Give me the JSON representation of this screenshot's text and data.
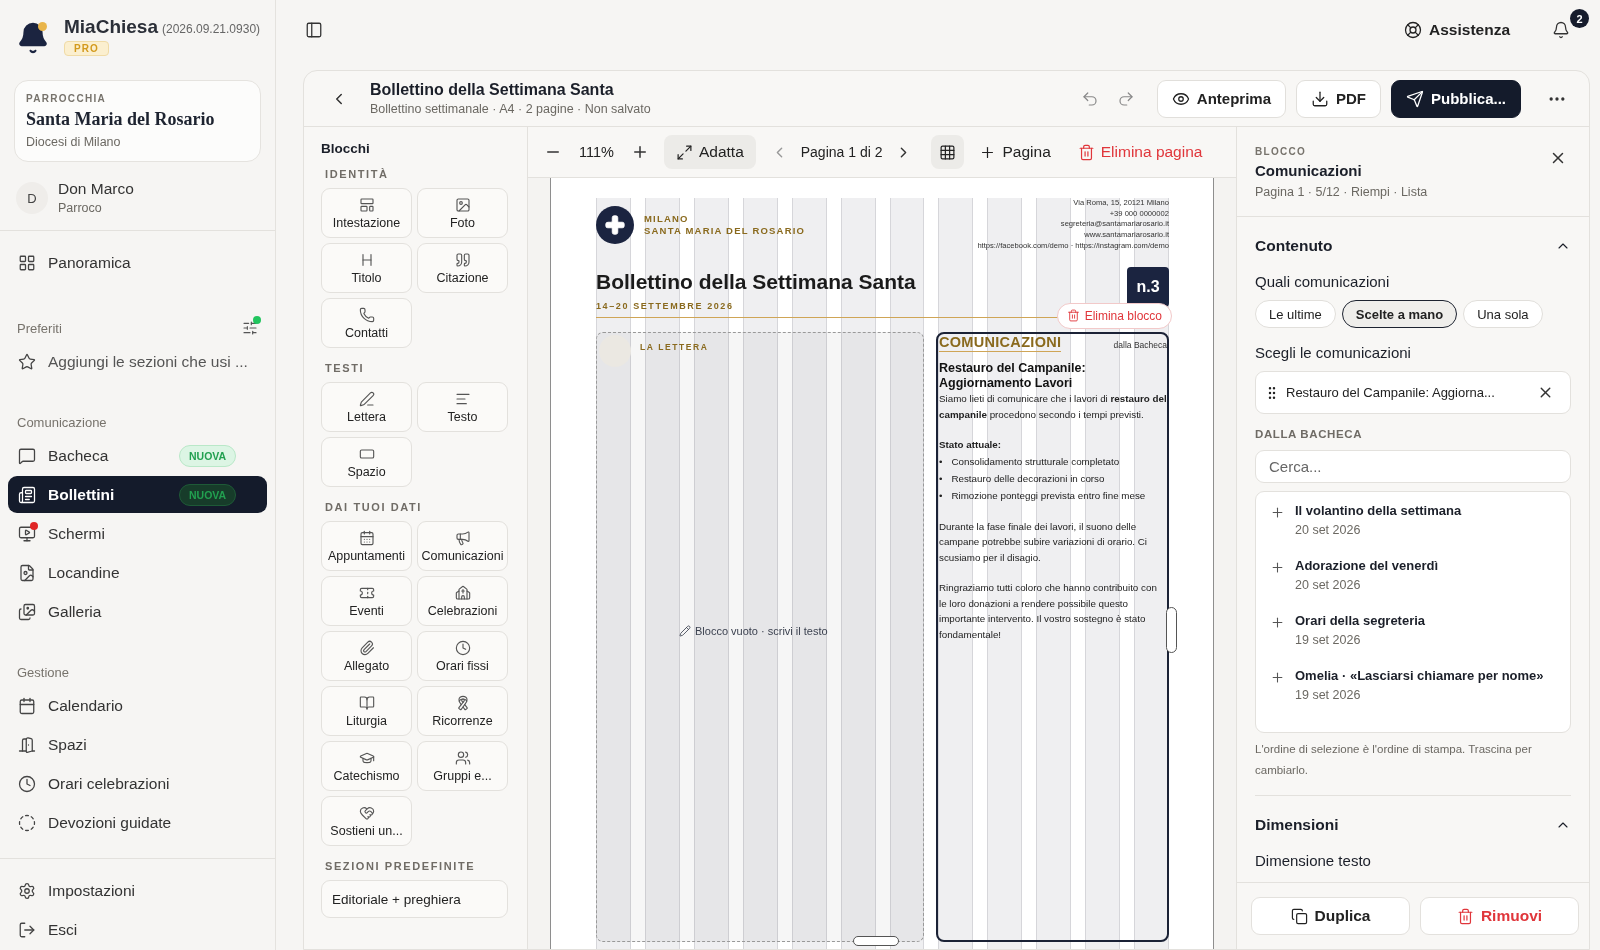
{
  "app": {
    "name": "MiaChiesa",
    "version": "(2026.09.21.0930)",
    "plan": "PRO"
  },
  "parish": {
    "label": "PARROCCHIA",
    "name": "Santa Maria del Rosario",
    "diocese": "Diocesi di Milano"
  },
  "user": {
    "initial": "D",
    "name": "Don Marco",
    "role": "Parroco"
  },
  "nav_top": [
    {
      "label": "Panoramica",
      "selected": false
    }
  ],
  "favorites": {
    "title": "Preferiti",
    "has_update": true,
    "hint": "Aggiungi le sezioni che usi ..."
  },
  "nav_sections": [
    {
      "title": "Comunicazione",
      "items": [
        {
          "label": "Bacheca",
          "badge": "NUOVA",
          "selected": false,
          "alert": false
        },
        {
          "label": "Bollettini",
          "badge": "NUOVA",
          "selected": true,
          "alert": false
        },
        {
          "label": "Schermi",
          "selected": false,
          "alert": true
        },
        {
          "label": "Locandine",
          "selected": false,
          "alert": false
        },
        {
          "label": "Galleria",
          "selected": false,
          "alert": false
        }
      ]
    },
    {
      "title": "Gestione",
      "items": [
        {
          "label": "Calendario",
          "selected": false,
          "alert": false
        },
        {
          "label": "Spazi",
          "selected": false,
          "alert": false
        },
        {
          "label": "Orari celebrazioni",
          "selected": false,
          "alert": false
        },
        {
          "label": "Devozioni guidate",
          "selected": false,
          "alert": false
        }
      ]
    }
  ],
  "nav_bottom": [
    {
      "label": "Impostazioni",
      "selected": false
    },
    {
      "label": "Esci",
      "selected": false
    }
  ],
  "topbar": {
    "help": "Assistenza",
    "notifications": "2"
  },
  "document": {
    "title": "Bollettino della Settimana Santa",
    "meta": "Bollettino settimanale · A4 · 2 pagine · Non salvato"
  },
  "header_buttons": [
    {
      "label": "Anteprima",
      "kind": "outline"
    },
    {
      "label": "PDF",
      "kind": "outline"
    },
    {
      "label": "Pubblica...",
      "kind": "primary"
    }
  ],
  "blocks": {
    "title": "Blocchi",
    "groups": [
      {
        "title": "IDENTITÀ",
        "items": [
          "Intestazione",
          "Foto",
          "Titolo",
          "Citazione",
          "Contatti"
        ]
      },
      {
        "title": "TESTI",
        "items": [
          "Lettera",
          "Testo",
          "Spazio"
        ]
      },
      {
        "title": "DAI TUOI DATI",
        "items": [
          "Appuntamenti",
          "Comunicazioni",
          "Eventi",
          "Celebrazioni",
          "Allegato",
          "Orari fissi",
          "Liturgia",
          "Ricorrenze",
          "Catechismo",
          "Gruppi e...",
          "Sostieni un..."
        ]
      }
    ],
    "presets_title": "SEZIONI PREDEFINITE",
    "presets": [
      "Editoriale + preghiera"
    ]
  },
  "toolbar": {
    "zoom": "111%",
    "fit": "Adatta",
    "page": "Pagina 1 di 2",
    "grid_selected": true,
    "add_page": "Pagina",
    "delete_page": "Elimina pagina"
  },
  "page": {
    "show_grid": true,
    "city": "MILANO",
    "parish": "SANTA MARIA DEL ROSARIO",
    "contacts": [
      "Via Roma, 15, 20121 Milano",
      "+39 000 0000002",
      "segreteria@santamariarosario.it",
      "www.santamariarosario.it",
      "https://facebook.com/demo · https://instagram.com/demo"
    ],
    "title": "Bollettino della Settimana Santa",
    "dates": "14–20 SETTEMBRE 2026",
    "issue": "n.3",
    "letter_block": {
      "label": "LA LETTERA",
      "placeholder": "Blocco vuoto · scrivi il testo",
      "selected": false
    },
    "news_block": {
      "heading": "COMUNICAZIONI",
      "source": "dalla Bacheca",
      "selected": true,
      "delete": "Elimina blocco",
      "title": "Restauro del Campanile: Aggiornamento Lavori",
      "content": [
        {
          "kind": "paragraph",
          "text": "Siamo lieti di comunicare che i lavori di **restauro del campanile** procedono secondo i tempi previsti."
        },
        {
          "kind": "heading",
          "text": "Stato attuale:"
        },
        {
          "kind": "list",
          "marker": "•",
          "items": [
            "Consolidamento strutturale completato",
            "Restauro delle decorazioni in corso",
            "Rimozione ponteggi prevista entro fine mese"
          ]
        },
        {
          "kind": "paragraph",
          "text": "Durante la fase finale dei lavori, il suono delle campane potrebbe subire variazioni di orario. Ci scusiamo per il disagio."
        },
        {
          "kind": "paragraph",
          "text": "Ringraziamo tutti coloro che hanno contribuito con le loro donazioni a rendere possibile questo importante intervento. Il vostro sostegno è stato fondamentale!"
        }
      ]
    }
  },
  "inspector": {
    "label": "BLOCCO",
    "title": "Comunicazioni",
    "meta": "Pagina 1 · 5/12 · Riempi · Lista",
    "content_section": {
      "title": "Contenuto",
      "expanded": true
    },
    "which": {
      "label": "Quali comunicazioni",
      "options": [
        {
          "label": "Le ultime",
          "selected": false
        },
        {
          "label": "Scelte a mano",
          "selected": true
        },
        {
          "label": "Una sola",
          "selected": false
        }
      ]
    },
    "chosen": {
      "label": "Scegli le comunicazioni",
      "items": [
        "Restauro del Campanile: Aggiorna..."
      ]
    },
    "board": {
      "label": "DALLA BACHECA",
      "search_placeholder": "Cerca...",
      "items": [
        {
          "title": "Il volantino della settimana",
          "date": "20 set 2026"
        },
        {
          "title": "Adorazione del venerdì",
          "date": "20 set 2026"
        },
        {
          "title": "Orari della segreteria",
          "date": "19 set 2026"
        },
        {
          "title": "Omelia · «Lasciarsi chiamare per nome»",
          "date": "19 set 2026"
        }
      ]
    },
    "note": "L'ordine di selezione è l'ordine di stampa. Trascina per cambiarlo.",
    "dimensions_section": {
      "title": "Dimensioni",
      "expanded": true,
      "label": "Dimensione testo"
    },
    "footer": {
      "duplicate": "Duplica",
      "remove": "Rimuovi"
    }
  }
}
